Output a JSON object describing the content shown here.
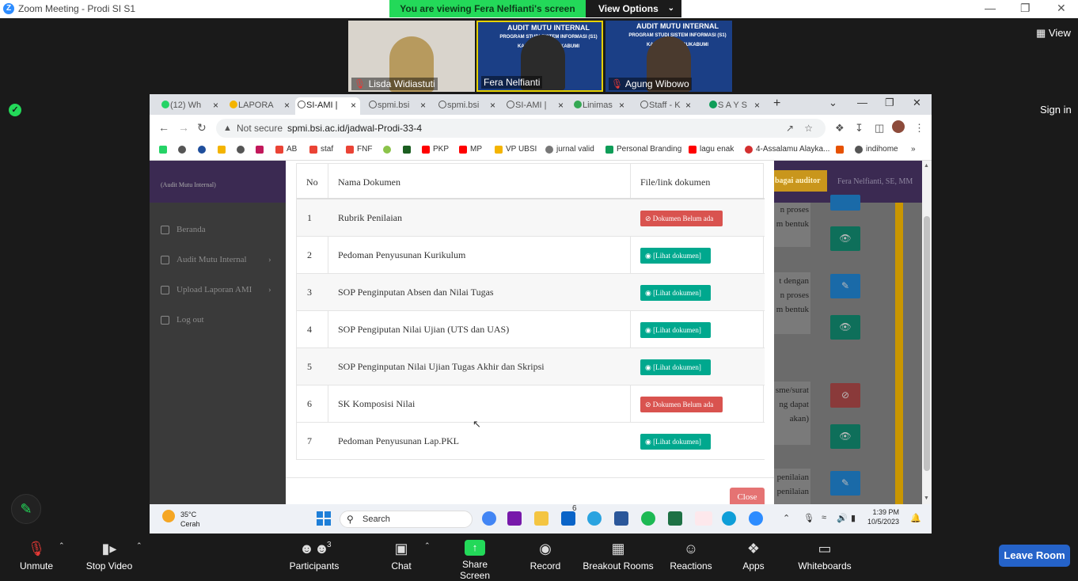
{
  "zoom": {
    "window_title": "Zoom Meeting - Prodi SI S1",
    "viewing_banner": "You are viewing Fera Nelfianti's screen",
    "view_options": "View Options",
    "view_button": "View",
    "sign_in": "Sign in",
    "participants_video": [
      {
        "name": "Lisda Widiastuti"
      },
      {
        "name": "Fera Nelfianti"
      },
      {
        "name": "Agung Wibowo"
      }
    ],
    "video_banner_text": "AUDIT MUTU INTERNAL",
    "video_banner_sub": "PROGRAM STUDI SISTEM INFORMASI (S1) KAMPUS KOTA SUKABUMI",
    "toolbar": {
      "unmute": "Unmute",
      "stop_video": "Stop Video",
      "participants": "Participants",
      "participants_count": "3",
      "chat": "Chat",
      "share_screen": "Share Screen",
      "record": "Record",
      "breakout_rooms": "Breakout Rooms",
      "reactions": "Reactions",
      "apps": "Apps",
      "whiteboards": "Whiteboards",
      "leave_room": "Leave Room"
    }
  },
  "browser": {
    "tabs": [
      {
        "label": "(12) Wh"
      },
      {
        "label": "LAPORA"
      },
      {
        "label": "SI-AMI |"
      },
      {
        "label": "spmi.bsi"
      },
      {
        "label": "spmi.bsi"
      },
      {
        "label": "SI-AMI |"
      },
      {
        "label": "Linimas"
      },
      {
        "label": "Staff - K"
      },
      {
        "label": "S A Y S"
      }
    ],
    "not_secure": "Not secure",
    "url": "spmi.bsi.ac.id/jadwal-Prodi-33-4",
    "bookmarks": [
      {
        "label": "",
        "color": "#25d366"
      },
      {
        "label": "",
        "color": "#555555"
      },
      {
        "label": "",
        "color": "#1f4e9c"
      },
      {
        "label": "",
        "color": "#f4b400"
      },
      {
        "label": "",
        "color": "#555555"
      },
      {
        "label": "",
        "color": "#c2185b"
      },
      {
        "label": "AB",
        "color": "#ea4335"
      },
      {
        "label": "staf",
        "color": "#ea4335"
      },
      {
        "label": "FNF",
        "color": "#ea4335"
      },
      {
        "label": "",
        "color": "#8bc34a"
      },
      {
        "label": "",
        "color": "#1b5e20"
      },
      {
        "label": "PKP",
        "color": "#ff0000"
      },
      {
        "label": "MP",
        "color": "#ff0000"
      },
      {
        "label": "VP UBSI",
        "color": "#f4b400"
      },
      {
        "label": "jurnal valid",
        "color": "#777777"
      },
      {
        "label": "Personal Branding",
        "color": "#0f9d58"
      },
      {
        "label": "lagu enak",
        "color": "#ff0000"
      },
      {
        "label": "4-Assalamu Alayka...",
        "color": "#d32f2f"
      },
      {
        "label": "",
        "color": "#e65100"
      },
      {
        "label": "indihome",
        "color": "#555555"
      }
    ]
  },
  "site": {
    "sidebar_header": "(Audit Mutu Internal)",
    "menu": [
      {
        "label": "Beranda"
      },
      {
        "label": "Audit Mutu Internal"
      },
      {
        "label": "Upload Laporan AMI"
      },
      {
        "label": "Log out"
      }
    ],
    "auditor_button": "bagai auditor",
    "user_name": "Fera Nelfianti, SE, MM",
    "right_texts": [
      {
        "line1": "n proses",
        "line2": "m bentuk"
      },
      {
        "line1": "t dengan",
        "line2": "n proses",
        "line3": "m bentuk"
      },
      {
        "line1": "sme/surat",
        "line2": "ng dapat",
        "line3": "akan)"
      },
      {
        "line1": "penilaian",
        "line2": "penilaian"
      }
    ]
  },
  "modal": {
    "columns": {
      "no": "No",
      "name": "Nama Dokumen",
      "file": "File/link dokumen"
    },
    "rows": [
      {
        "no": "1",
        "name": "Rubrik Penilaian",
        "status": "Dokumen Belum ada",
        "type": "missing"
      },
      {
        "no": "2",
        "name": "Pedoman Penyusunan Kurikulum",
        "status": "[Lihat dokumen]",
        "type": "view"
      },
      {
        "no": "3",
        "name": "SOP Penginputan Absen dan Nilai Tugas",
        "status": "[Lihat dokumen]",
        "type": "view"
      },
      {
        "no": "4",
        "name": "SOP Pengiputan Nilai Ujian (UTS dan UAS)",
        "status": "[Lihat dokumen]",
        "type": "view"
      },
      {
        "no": "5",
        "name": "SOP Penginputan Nilai Ujian Tugas Akhir dan Skripsi",
        "status": "[Lihat dokumen]",
        "type": "view"
      },
      {
        "no": "6",
        "name": "SK Komposisi Nilai",
        "status": "Dokumen Belum ada",
        "type": "missing"
      },
      {
        "no": "7",
        "name": "Pedoman Penyusunan Lap.PKL",
        "status": "[Lihat dokumen]",
        "type": "view"
      }
    ],
    "close": "Close"
  },
  "taskbar": {
    "temperature": "35°C",
    "weather": "Cerah",
    "search": "Search",
    "time": "1:39 PM",
    "date": "10/5/2023",
    "mail_badge": "6"
  }
}
